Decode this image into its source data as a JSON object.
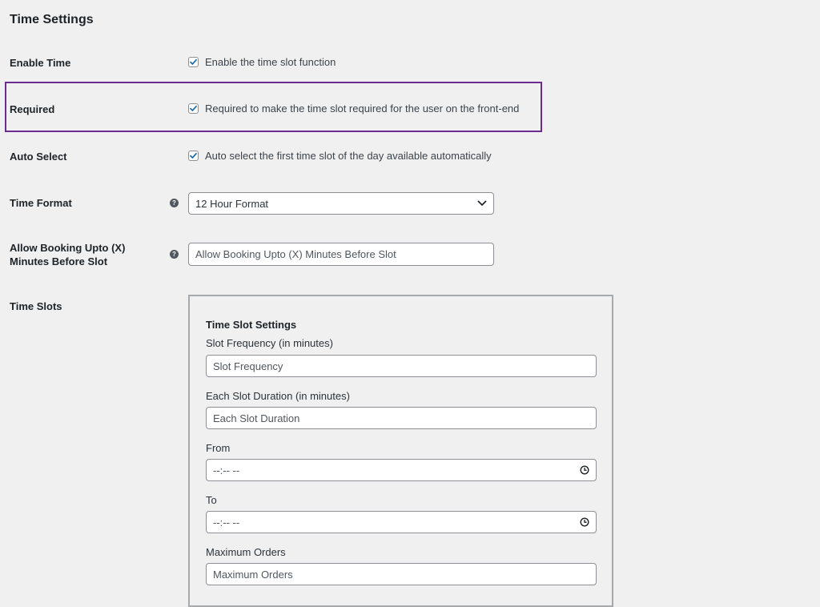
{
  "section": {
    "title": "Time Settings"
  },
  "rows": {
    "enable_time": {
      "label": "Enable Time",
      "checkbox_text": "Enable the time slot function",
      "checked": true
    },
    "required": {
      "label": "Required",
      "checkbox_text": "Required to make the time slot required for the user on the front-end",
      "checked": true
    },
    "auto_select": {
      "label": "Auto Select",
      "checkbox_text": "Auto select the first time slot of the day available automatically",
      "checked": true
    },
    "time_format": {
      "label": "Time Format",
      "selected": "12 Hour Format"
    },
    "allow_booking": {
      "label_line1": "Allow Booking Upto (X)",
      "label_line2": "Minutes Before Slot",
      "placeholder": "Allow Booking Upto (X) Minutes Before Slot"
    },
    "time_slots": {
      "label": "Time Slots"
    }
  },
  "time_slot_settings": {
    "title": "Time Slot Settings",
    "slot_frequency": {
      "label": "Slot Frequency (in minutes)",
      "placeholder": "Slot Frequency"
    },
    "slot_duration": {
      "label": "Each Slot Duration (in minutes)",
      "placeholder": "Each Slot Duration"
    },
    "from": {
      "label": "From",
      "value": "--:-- --"
    },
    "to": {
      "label": "To",
      "value": "--:-- --"
    },
    "max_orders": {
      "label": "Maximum Orders",
      "placeholder": "Maximum Orders"
    }
  },
  "colors": {
    "highlight_border": "#6b2c8f",
    "checkbox_check": "#2271b1"
  }
}
